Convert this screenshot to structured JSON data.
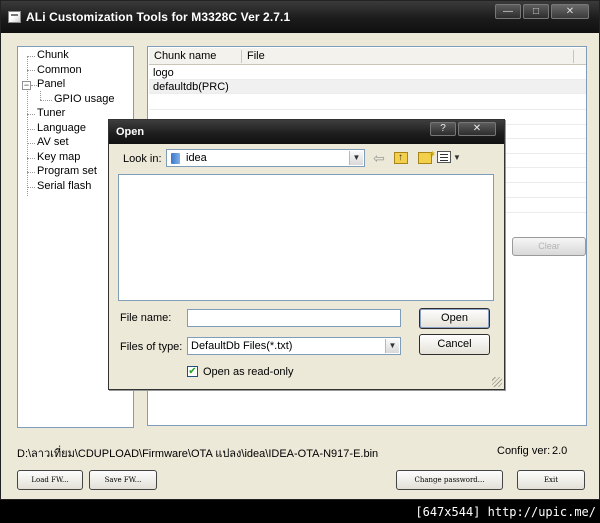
{
  "window": {
    "title": "ALi Customization Tools for M3328C  Ver 2.7.1",
    "controls": {
      "minimize": "—",
      "maximize": "□",
      "close": "✕"
    }
  },
  "tree": {
    "items": [
      {
        "label": "Chunk"
      },
      {
        "label": "Common"
      },
      {
        "label": "Panel",
        "expander": "−"
      },
      {
        "label": "GPIO usage"
      },
      {
        "label": "Tuner"
      },
      {
        "label": "Language"
      },
      {
        "label": "AV set"
      },
      {
        "label": "Key map"
      },
      {
        "label": "Program set"
      },
      {
        "label": "Serial flash"
      }
    ]
  },
  "chunk_list": {
    "columns": [
      "Chunk name",
      "File"
    ],
    "rows": [
      {
        "name": "logo"
      },
      {
        "name": "defaultdb(PRC)"
      }
    ]
  },
  "buttons": {
    "clear": "Clear",
    "load_fw": "Load FW...",
    "save_fw": "Save FW...",
    "change_password": "Change password...",
    "exit": "Exit"
  },
  "status": {
    "path": "D:\\ลาวเที่ยม\\CDUPLOAD\\Firmware\\OTA แปลง\\idea\\IDEA-OTA-N917-E.bin",
    "config_label": "Config ver:",
    "config_value": "2.0"
  },
  "open_dialog": {
    "title": "Open",
    "controls": {
      "help": "?",
      "close": "✕"
    },
    "look_in_label": "Look in:",
    "look_in_value": "idea",
    "file_name_label": "File name:",
    "file_name_value": "",
    "files_of_type_label": "Files of type:",
    "files_of_type_value": "DefaultDb Files(*.txt)",
    "open_button": "Open",
    "cancel_button": "Cancel",
    "read_only_label": "Open as read-only",
    "read_only_checked": true,
    "check_mark": "✔"
  },
  "watermark": "[647x544] http://upic.me/"
}
